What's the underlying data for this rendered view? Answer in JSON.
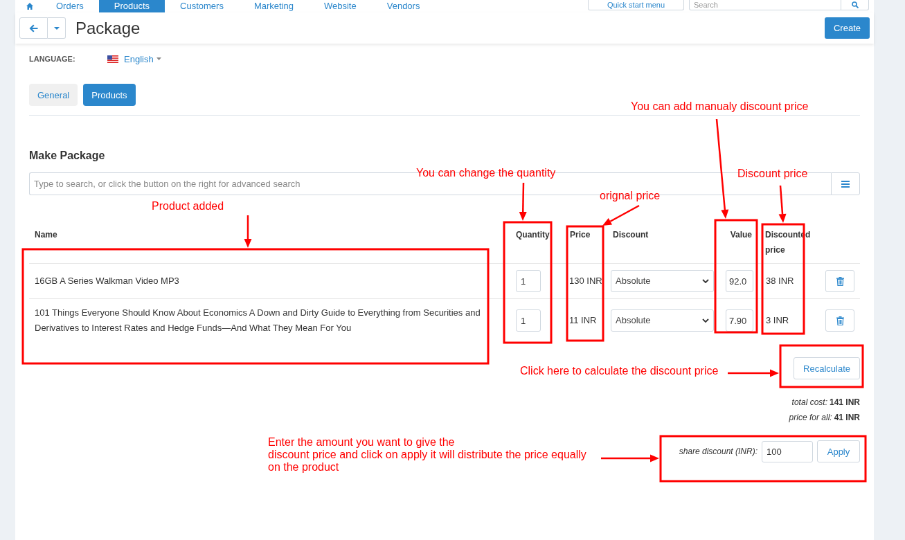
{
  "top_nav": {
    "items": [
      {
        "label": "Orders",
        "selected": false
      },
      {
        "label": "Products",
        "selected": true
      },
      {
        "label": "Customers",
        "selected": false
      },
      {
        "label": "Marketing",
        "selected": false
      },
      {
        "label": "Website",
        "selected": false
      },
      {
        "label": "Vendors",
        "selected": false
      }
    ],
    "quick_start_button": "Quick start menu",
    "search": {
      "placeholder": "Search"
    }
  },
  "header": {
    "title": "Package",
    "create_button": "Create"
  },
  "language": {
    "label": "LANGUAGE:",
    "value": "English"
  },
  "tabs": [
    {
      "label": "General",
      "selected": false
    },
    {
      "label": "Products",
      "selected": true
    }
  ],
  "section_title": "Make Package",
  "product_search": {
    "placeholder": "Type to search, or click the button on the right for advanced search"
  },
  "table": {
    "columns": [
      "Name",
      "Quantity",
      "Price",
      "Discount",
      "Value",
      "Discounted price"
    ],
    "rows": [
      {
        "name": "16GB A Series Walkman Video MP3",
        "quantity": "1",
        "price": "130 INR",
        "discount": "Absolute",
        "value": "92.0",
        "discounted_price": "38 INR"
      },
      {
        "name": "101 Things Everyone Should Know About Economics A Down and Dirty Guide to Everything from Securities and Derivatives to Interest Rates and Hedge Funds—And What They Mean For You",
        "quantity": "1",
        "price": "11 INR",
        "discount": "Absolute",
        "value": "7.90",
        "discounted_price": "3 INR"
      }
    ]
  },
  "recalculate_button": "Recalculate",
  "totals": [
    {
      "label": "total cost:",
      "value": "141 INR"
    },
    {
      "label": "price for all:",
      "value": "41 INR"
    }
  ],
  "share_discount": {
    "label": "share discount (INR):",
    "value": "100",
    "button": "Apply"
  },
  "annotations": [
    {
      "text": "You can add manualy discount price"
    },
    {
      "text": "You can change the quantity"
    },
    {
      "text": "Discount price"
    },
    {
      "text": "orignal price"
    },
    {
      "text": "Product added"
    },
    {
      "text": "Click here to calculate the discount price"
    },
    {
      "text": "Enter the amount you want to give the\ndiscount price and click on apply it will distribute the price equally\non the product"
    }
  ]
}
